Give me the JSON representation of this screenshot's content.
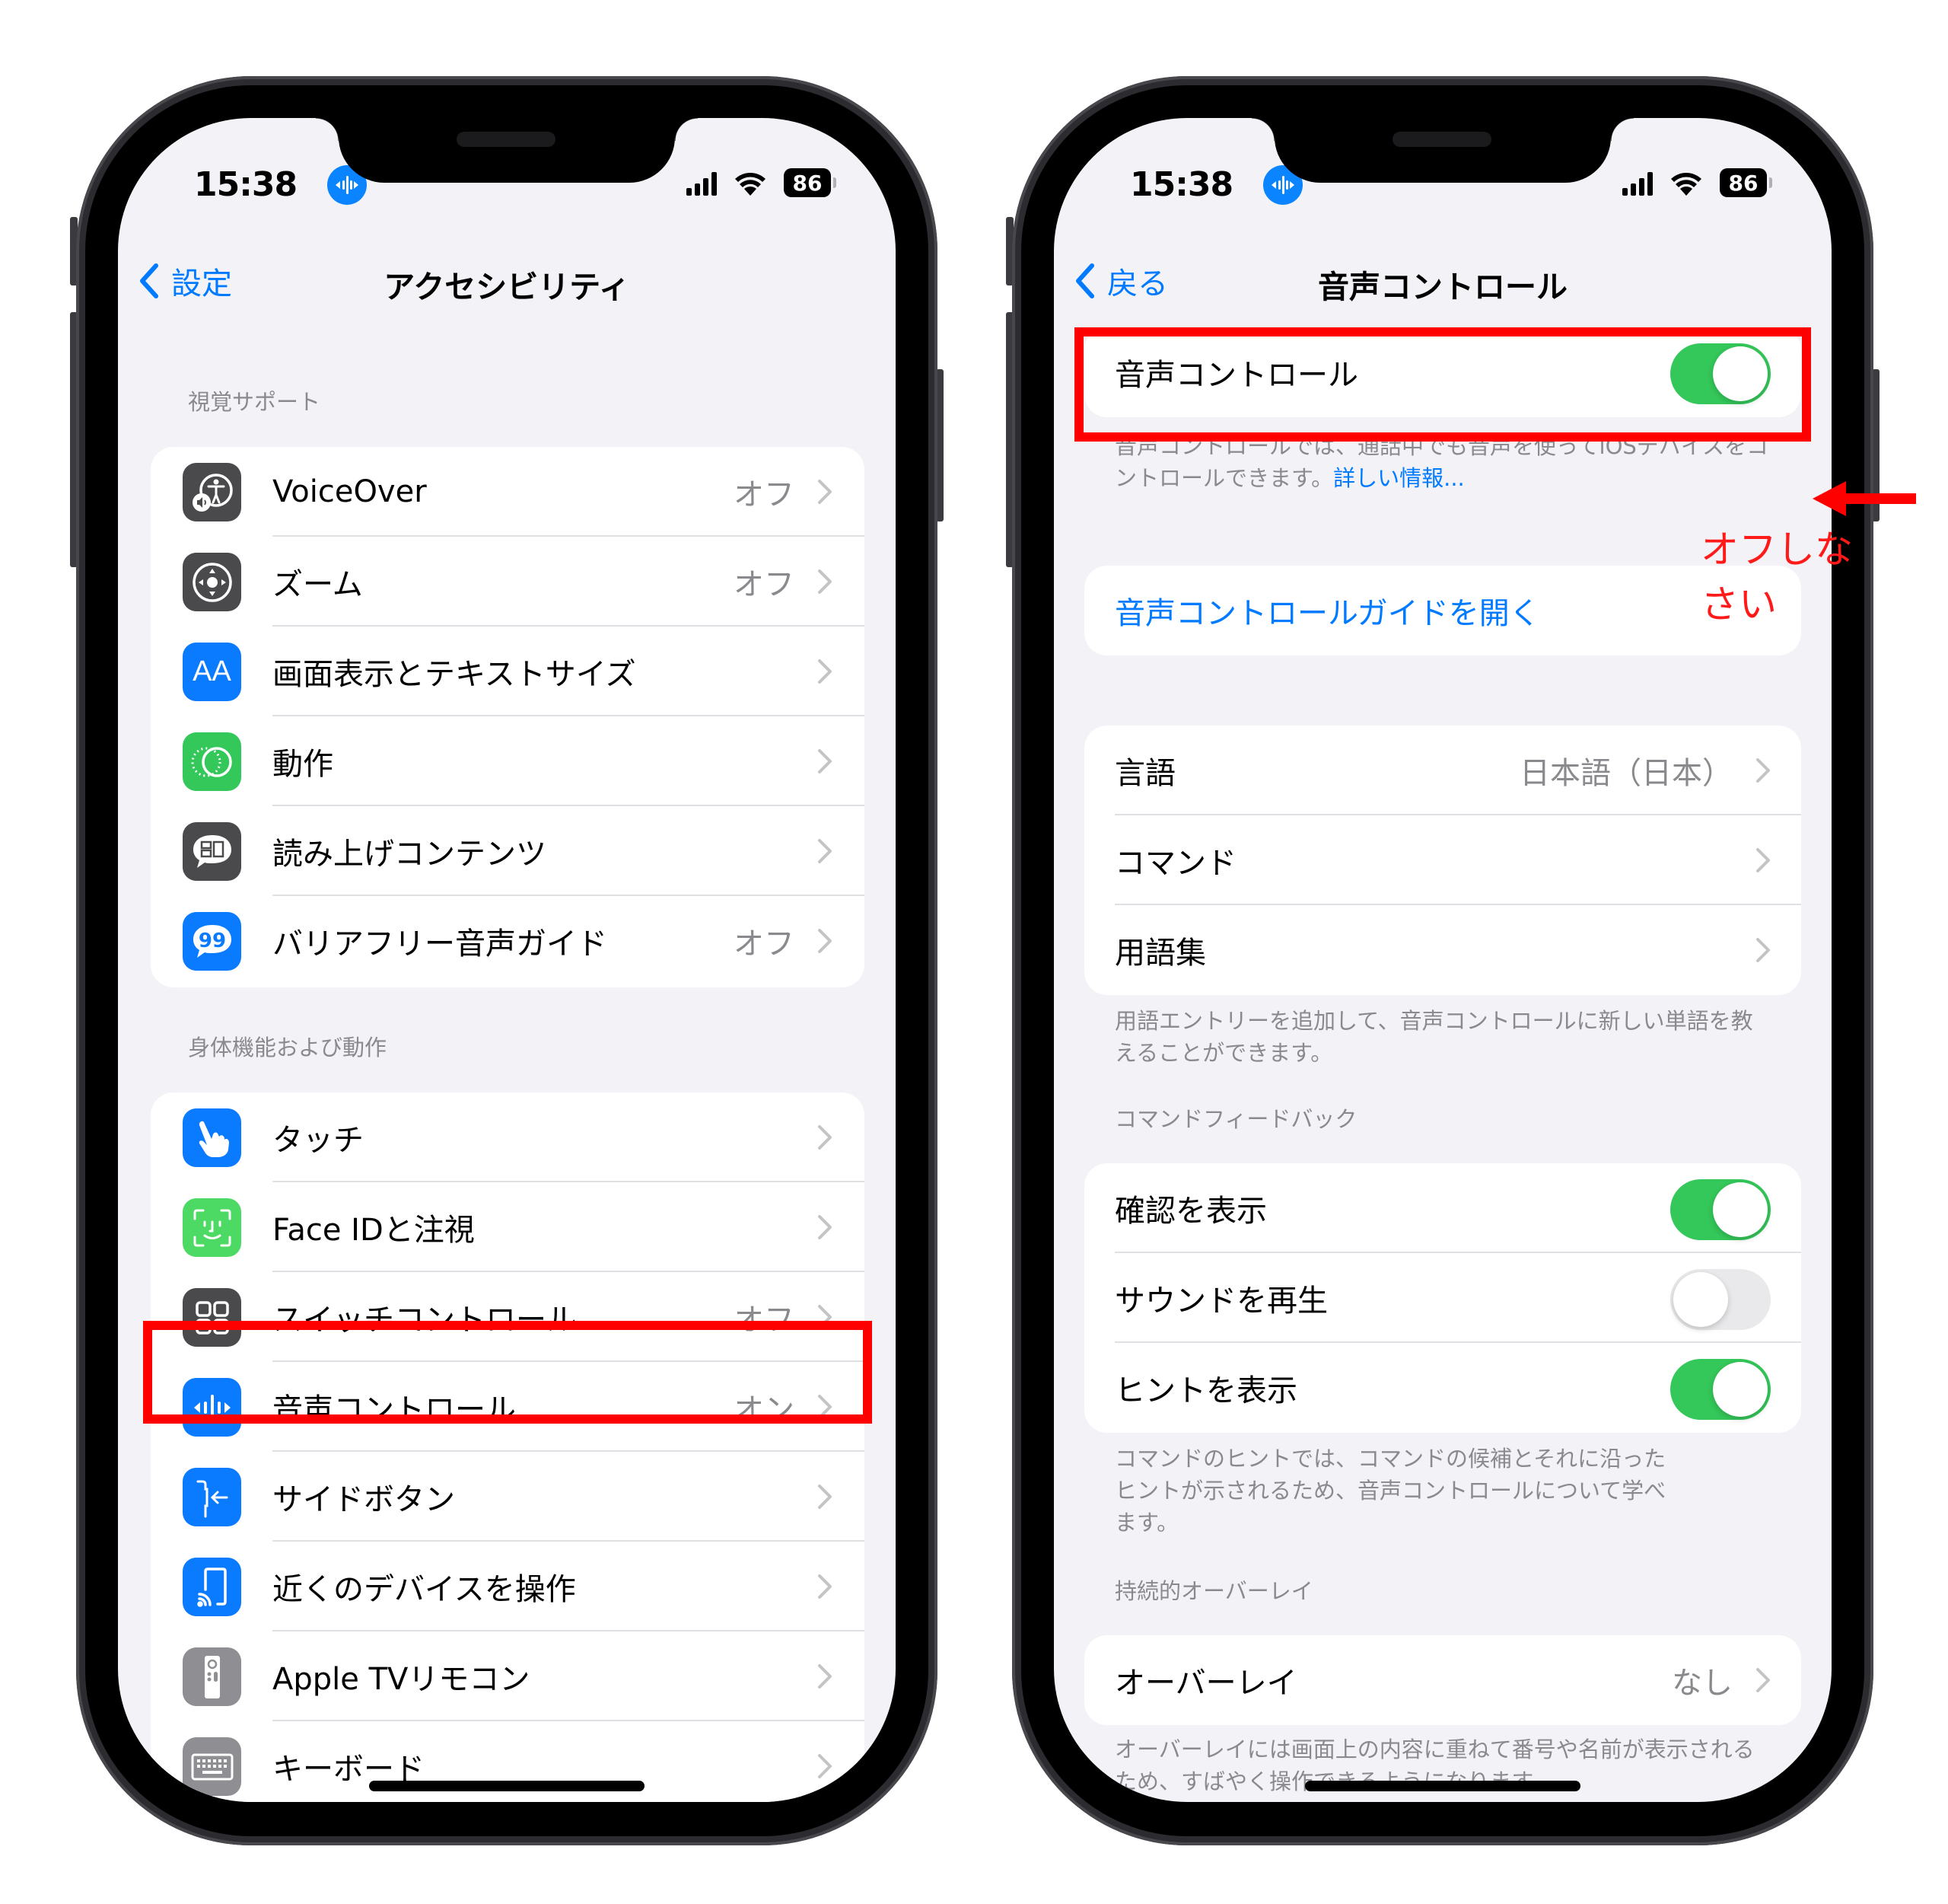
{
  "status_bar": {
    "time": "15:38",
    "battery": "86",
    "mic_indicator_icon": "voice-control-waveform-icon"
  },
  "left_screen": {
    "nav": {
      "back_label": "設定",
      "title": "アクセシビリティ"
    },
    "sections": [
      {
        "header": "視覚サポート",
        "items": [
          {
            "label": "VoiceOver",
            "value": "オフ",
            "icon": "voiceover-icon",
            "icon_color": "#4a4a4d"
          },
          {
            "label": "ズーム",
            "value": "オフ",
            "icon": "zoom-icon",
            "icon_color": "#4a4a4d"
          },
          {
            "label": "画面表示とテキストサイズ",
            "value": "",
            "icon": "display-text-size-icon",
            "icon_color": "#0a7aff",
            "icon_text": "AA"
          },
          {
            "label": "動作",
            "value": "",
            "icon": "motion-icon",
            "icon_color": "#34c759"
          },
          {
            "label": "読み上げコンテンツ",
            "value": "",
            "icon": "spoken-content-icon",
            "icon_color": "#4a4a4d"
          },
          {
            "label": "バリアフリー音声ガイド",
            "value": "オフ",
            "icon": "audio-descriptions-icon",
            "icon_color": "#0a7aff"
          }
        ]
      },
      {
        "header": "身体機能および動作",
        "items": [
          {
            "label": "タッチ",
            "value": "",
            "icon": "touch-icon",
            "icon_color": "#0a7aff"
          },
          {
            "label": "Face IDと注視",
            "value": "",
            "icon": "face-id-icon",
            "icon_color": "#4cd964"
          },
          {
            "label": "スイッチコントロール",
            "value": "オフ",
            "icon": "switch-control-icon",
            "icon_color": "#4a4a4d"
          },
          {
            "label": "音声コントロール",
            "value": "オン",
            "icon": "voice-control-icon",
            "icon_color": "#0a7aff",
            "highlighted": true
          },
          {
            "label": "サイドボタン",
            "value": "",
            "icon": "side-button-icon",
            "icon_color": "#0a7aff"
          },
          {
            "label": "近くのデバイスを操作",
            "value": "",
            "icon": "control-nearby-devices-icon",
            "icon_color": "#0a7aff"
          },
          {
            "label": "Apple TVリモコン",
            "value": "",
            "icon": "apple-tv-remote-icon",
            "icon_color": "#8e8e93"
          },
          {
            "label": "キーボード",
            "value": "",
            "icon": "keyboard-icon",
            "icon_color": "#8e8e93"
          }
        ]
      }
    ]
  },
  "right_screen": {
    "nav": {
      "back_label": "戻る",
      "title": "音声コントロール"
    },
    "main_toggle": {
      "label": "音声コントロール",
      "on": true
    },
    "main_footer": "音声コントロールでは、通話中でも音声を使ってiOSデバイスをコントロールできます。",
    "main_footer_link": "詳しい情報...",
    "guide_link": "音声コントロールガイドを開く",
    "settings": [
      {
        "label": "言語",
        "value": "日本語（日本）"
      },
      {
        "label": "コマンド",
        "value": ""
      },
      {
        "label": "用語集",
        "value": ""
      }
    ],
    "settings_footer": "用語エントリーを追加して、音声コントロールに新しい単語を教えることができます。",
    "feedback_header": "コマンドフィードバック",
    "feedback": [
      {
        "label": "確認を表示",
        "on": true
      },
      {
        "label": "サウンドを再生",
        "on": false
      },
      {
        "label": "ヒントを表示",
        "on": true
      }
    ],
    "feedback_footer": "コマンドのヒントでは、コマンドの候補とそれに沿ったヒントが示されるため、音声コントロールについて学べます。",
    "overlay_header": "持続的オーバーレイ",
    "overlay": {
      "label": "オーバーレイ",
      "value": "なし"
    },
    "overlay_footer": "オーバーレイには画面上の内容に重ねて番号や名前が表示されるため、すばやく操作できるようになります。"
  },
  "annotation": {
    "text": "オフしなさい",
    "color": "#ff0000"
  }
}
